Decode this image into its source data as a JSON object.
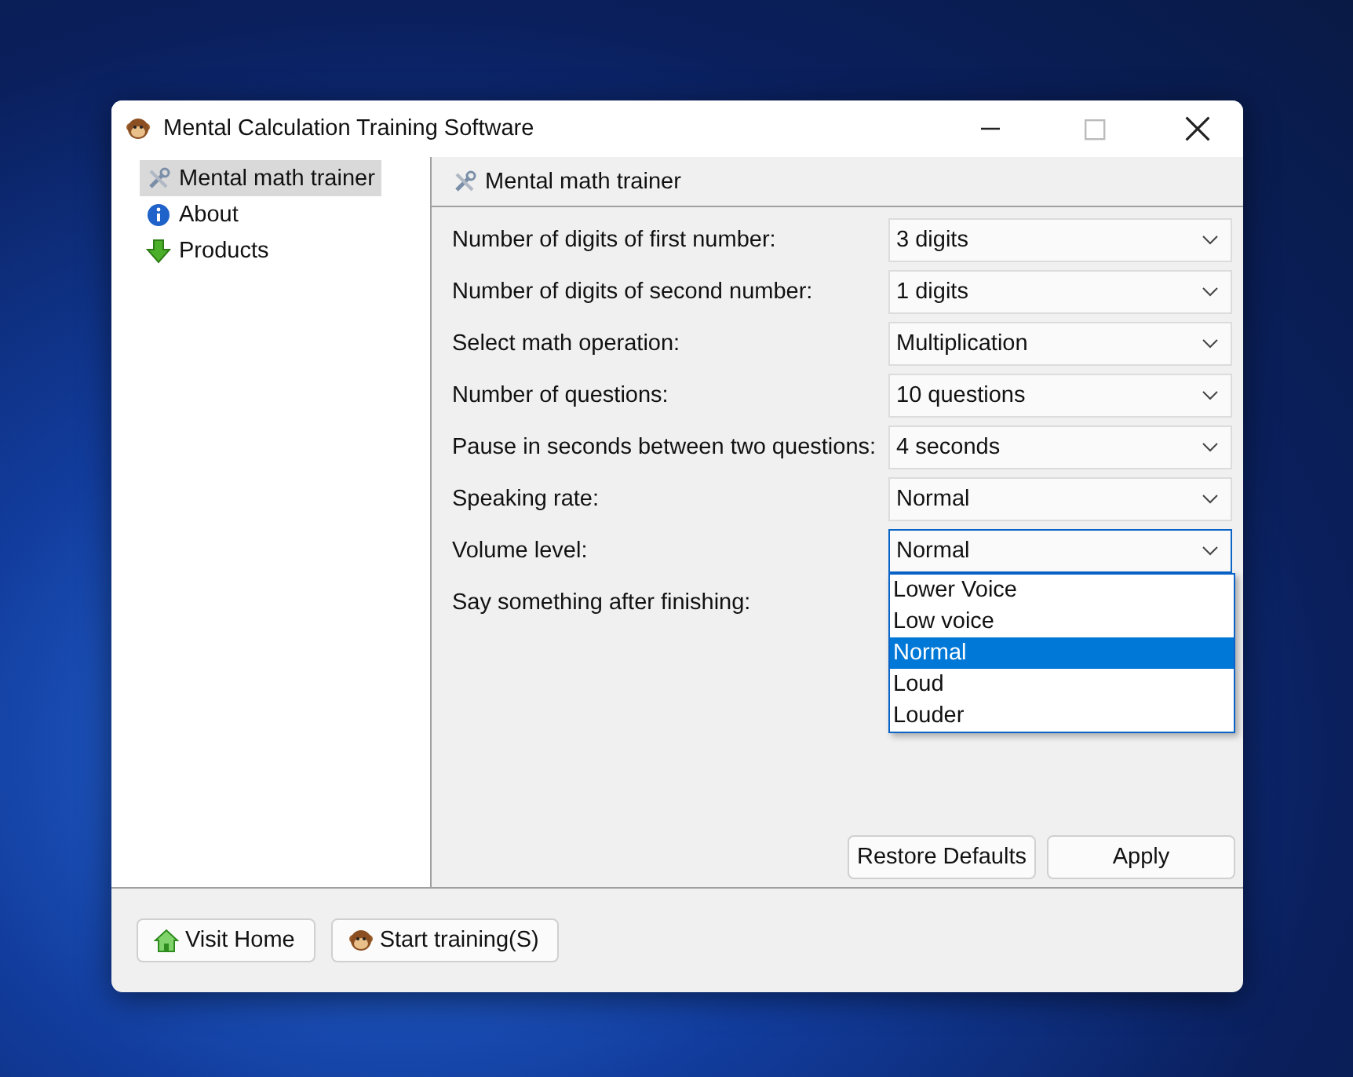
{
  "window": {
    "title": "Mental Calculation Training Software"
  },
  "sidebar": {
    "items": [
      {
        "label": "Mental math trainer",
        "kind": "tools",
        "selected": true
      },
      {
        "label": "About",
        "kind": "info",
        "selected": false
      },
      {
        "label": "Products",
        "kind": "download",
        "selected": false
      }
    ]
  },
  "panel": {
    "title": "Mental math trainer",
    "settings": [
      {
        "label": "Number of digits of first number:",
        "value": "3 digits"
      },
      {
        "label": "Number of digits of second number:",
        "value": "1 digits"
      },
      {
        "label": "Select math operation:",
        "value": "Multiplication"
      },
      {
        "label": "Number of questions:",
        "value": "10 questions"
      },
      {
        "label": "Pause in seconds between two questions:",
        "value": "4 seconds"
      },
      {
        "label": "Speaking rate:",
        "value": "Normal"
      },
      {
        "label": "Volume level:",
        "value": "Normal",
        "open": true,
        "options": [
          {
            "label": "Lower Voice",
            "selected": false
          },
          {
            "label": "Low voice",
            "selected": false
          },
          {
            "label": "Normal",
            "selected": true
          },
          {
            "label": "Loud",
            "selected": false
          },
          {
            "label": "Louder",
            "selected": false
          }
        ]
      },
      {
        "label": "Say something after finishing:"
      }
    ],
    "buttons": [
      "Restore Defaults",
      "Apply"
    ]
  },
  "footer": {
    "buttons": [
      {
        "label": "Visit Home",
        "kind": "home"
      },
      {
        "label": "Start training(S)",
        "kind": "start"
      }
    ]
  }
}
